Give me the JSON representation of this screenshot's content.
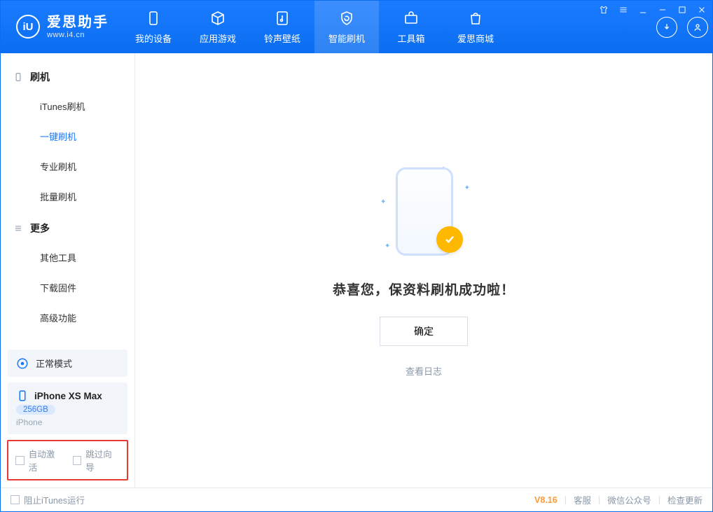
{
  "app": {
    "name_cn": "爱思助手",
    "name_en": "www.i4.cn"
  },
  "tabs": [
    {
      "id": "device",
      "label": "我的设备"
    },
    {
      "id": "apps",
      "label": "应用游戏"
    },
    {
      "id": "media",
      "label": "铃声壁纸"
    },
    {
      "id": "flash",
      "label": "智能刷机"
    },
    {
      "id": "toolbox",
      "label": "工具箱"
    },
    {
      "id": "store",
      "label": "爱思商城"
    }
  ],
  "sidebar": {
    "section_flash": "刷机",
    "items_flash": [
      "iTunes刷机",
      "一键刷机",
      "专业刷机",
      "批量刷机"
    ],
    "section_more": "更多",
    "items_more": [
      "其他工具",
      "下载固件",
      "高级功能"
    ],
    "mode": "正常模式",
    "device": {
      "name": "iPhone XS Max",
      "capacity": "256GB",
      "type": "iPhone"
    },
    "opt_auto_activate": "自动激活",
    "opt_skip_guide": "跳过向导"
  },
  "main": {
    "message": "恭喜您，保资料刷机成功啦！",
    "ok": "确定",
    "view_log": "查看日志"
  },
  "footer": {
    "stop_itunes": "阻止iTunes运行",
    "version": "V8.16",
    "links": [
      "客服",
      "微信公众号",
      "检查更新"
    ]
  }
}
